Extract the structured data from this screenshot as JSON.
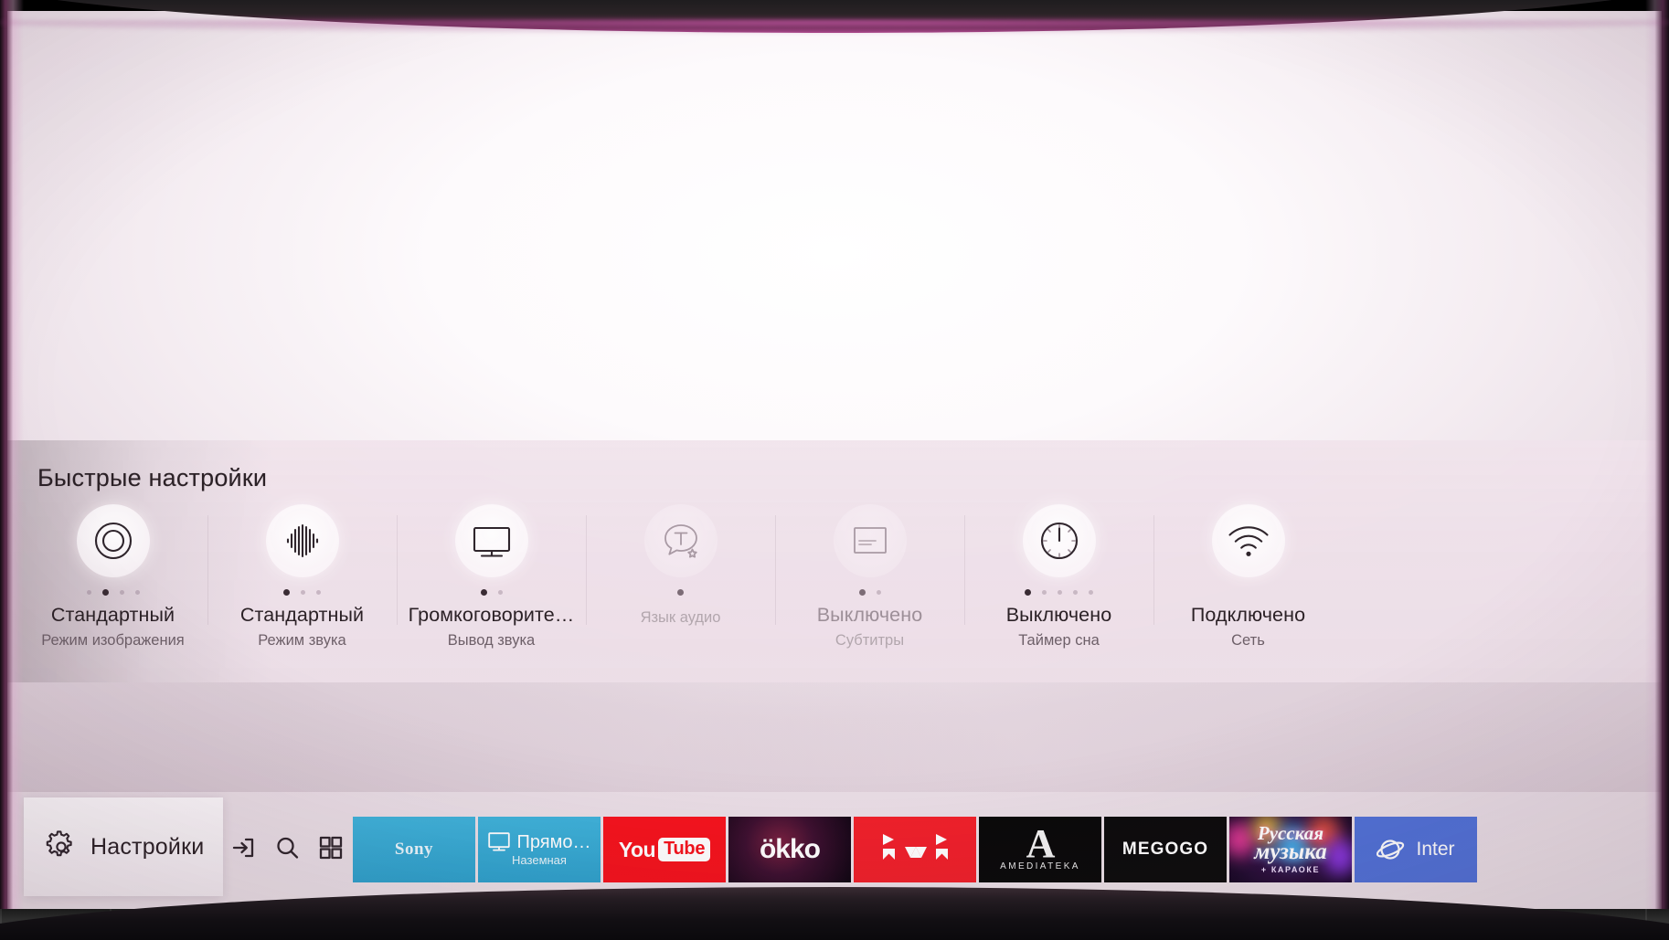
{
  "panel": {
    "title": "Быстрые настройки"
  },
  "quick_settings": [
    {
      "icon": "picture-mode-icon",
      "value": "Стандартный",
      "sublabel": "Режим изображения",
      "dots": 4,
      "active_dot": 2,
      "dim": false
    },
    {
      "icon": "sound-mode-icon",
      "value": "Стандартный",
      "sublabel": "Режим звука",
      "dots": 3,
      "active_dot": 1,
      "dim": false
    },
    {
      "icon": "sound-output-icon",
      "value": "Громкоговорите…",
      "sublabel": "Вывод звука",
      "dots": 2,
      "active_dot": 1,
      "dim": false
    },
    {
      "icon": "audio-language-icon",
      "value": "",
      "sublabel": "Язык аудио",
      "dots": 1,
      "active_dot": 1,
      "dim": true
    },
    {
      "icon": "subtitles-icon",
      "value": "Выключено",
      "sublabel": "Субтитры",
      "dots": 2,
      "active_dot": 1,
      "dim": true
    },
    {
      "icon": "sleep-timer-icon",
      "value": "Выключено",
      "sublabel": "Таймер сна",
      "dots": 5,
      "active_dot": 1,
      "dim": false
    },
    {
      "icon": "network-wifi-icon",
      "value": "Подключено",
      "sublabel": "Сеть",
      "dots": 0,
      "active_dot": 0,
      "dim": false
    }
  ],
  "bottom_bar": {
    "settings_label": "Настройки",
    "icons": [
      {
        "name": "source-input-icon"
      },
      {
        "name": "search-icon"
      },
      {
        "name": "apps-grid-icon"
      }
    ]
  },
  "tiles": [
    {
      "name": "sony",
      "label": "Sony",
      "sublabel": "",
      "color": "#2ea2cd"
    },
    {
      "name": "live-tv",
      "label": "Прямо…",
      "sublabel": "Наземная",
      "color": "#2ea2cd"
    },
    {
      "name": "youtube",
      "label": "YouTube",
      "label_a": "You",
      "label_b": "Tube",
      "sublabel": "",
      "color": "#f5131d"
    },
    {
      "name": "okko",
      "label": "ökko",
      "sublabel": "",
      "color": "#0b0510"
    },
    {
      "name": "ivi",
      "label": "ivi",
      "sublabel": "",
      "color": "#f0202b"
    },
    {
      "name": "amediateka",
      "label": "A",
      "sublabel": "AMEDIATEKA",
      "color": "#0a0a0a"
    },
    {
      "name": "megogo",
      "label": "MEGOGO",
      "sublabel": "",
      "color": "#0c0c0c"
    },
    {
      "name": "rus-music",
      "label": "Русская",
      "label_b": "музыка",
      "sublabel": "+ КАРАОКЕ",
      "color": "#2a0f3c"
    },
    {
      "name": "internet",
      "label": "Inter",
      "sublabel": "",
      "color": "#5172d8"
    }
  ],
  "colors": {
    "panel_bg": "#ece0e9",
    "text_primary": "#2b2126",
    "text_secondary": "#6d5f68",
    "accent_blue": "#2ea2cd",
    "accent_red": "#f5131d"
  }
}
